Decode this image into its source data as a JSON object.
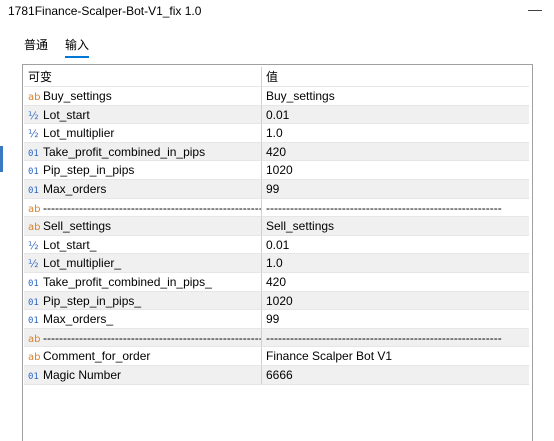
{
  "window": {
    "title": "1781Finance-Scalper-Bot-V1_fix 1.0",
    "minimize": "—"
  },
  "tabs": [
    {
      "label": "普通"
    },
    {
      "label": "输入"
    }
  ],
  "table": {
    "headers": {
      "name": "可变",
      "value": "值"
    },
    "rows": [
      {
        "icon": "ab",
        "name": "Buy_settings",
        "value": "Buy_settings"
      },
      {
        "icon": "½",
        "name": "Lot_start",
        "value": "0.01"
      },
      {
        "icon": "½",
        "name": "Lot_multiplier",
        "value": "1.0"
      },
      {
        "icon": "01",
        "name": "Take_profit_combined_in_pips",
        "value": "420"
      },
      {
        "icon": "01",
        "name": "Pip_step_in_pips",
        "value": "1020"
      },
      {
        "icon": "01",
        "name": "Max_orders",
        "value": "99"
      },
      {
        "icon": "ab",
        "name": "--------------------------------------------------------",
        "value": "-----------------------------------------------------------"
      },
      {
        "icon": "ab",
        "name": "Sell_settings",
        "value": "Sell_settings"
      },
      {
        "icon": "½",
        "name": "Lot_start_",
        "value": "0.01"
      },
      {
        "icon": "½",
        "name": "Lot_multiplier_",
        "value": "1.0"
      },
      {
        "icon": "01",
        "name": "Take_profit_combined_in_pips_",
        "value": "420"
      },
      {
        "icon": "01",
        "name": "Pip_step_in_pips_",
        "value": "1020"
      },
      {
        "icon": "01",
        "name": "Max_orders_",
        "value": "99"
      },
      {
        "icon": "ab",
        "name": "--------------------------------------------------------",
        "value": "-----------------------------------------------------------"
      },
      {
        "icon": "ab",
        "name": "Comment_for_order",
        "value": " Finance Scalper Bot V1"
      },
      {
        "icon": "01",
        "name": "Magic Number",
        "value": "6666"
      }
    ]
  }
}
